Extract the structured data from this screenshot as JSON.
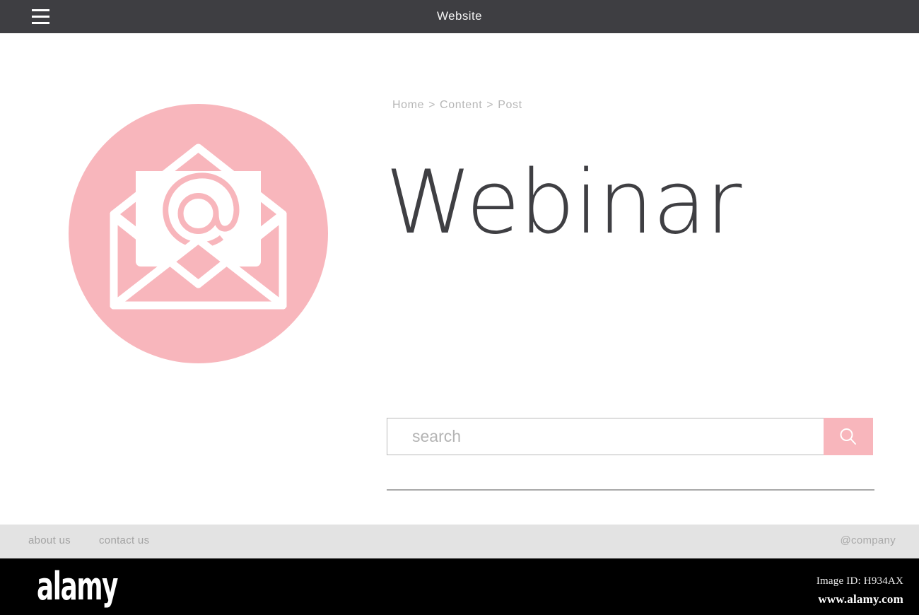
{
  "topbar": {
    "title": "Website",
    "menu_icon": "hamburger-menu-icon"
  },
  "breadcrumb": {
    "items": [
      "Home",
      "Content",
      "Post"
    ],
    "separator": ">"
  },
  "hero": {
    "headline": "Webinar",
    "icon": "email-envelope-icon",
    "icon_symbol": "@",
    "icon_bg_color": "#F8B6BC"
  },
  "search": {
    "value": "",
    "placeholder": "search",
    "button_icon": "search-magnifier-icon",
    "button_color": "#F8B6BC"
  },
  "footer": {
    "about": "about us",
    "contact": "contact us",
    "company": "@company"
  },
  "watermark": {
    "text": "alamy",
    "letters": [
      "a",
      "l",
      "a",
      "m",
      "y"
    ]
  },
  "stock_bar": {
    "logo": "alamy",
    "image_id": "Image ID: H934AX",
    "url": "www.alamy.com"
  },
  "colors": {
    "topbar_bg": "#3E3E42",
    "page_bg": "#FFFFFF",
    "footer_bg": "#E3E3E3",
    "accent_pink": "#F8B6BC",
    "headline": "#3F3F43",
    "muted_text": "#B6B6B6"
  }
}
